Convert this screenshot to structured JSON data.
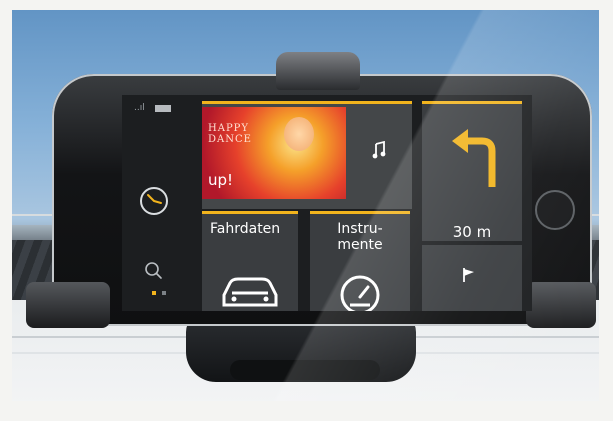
{
  "status_bar": {
    "signal": "..ıl"
  },
  "music": {
    "album_title": "HAPPY\nDANCE",
    "album_subtitle": "up!",
    "icon": "music-note-icon"
  },
  "navigation": {
    "icon": "turn-left-arrow-icon",
    "distance": "30 m",
    "flag_icon": "destination-flag-icon"
  },
  "tiles": {
    "fahrdaten_label": "Fahrdaten",
    "instrumente_label": "Instru-\nmente"
  },
  "side": {
    "clock_icon": "clock-icon",
    "search_icon": "search-icon"
  },
  "colors": {
    "accent": "#f2b41d",
    "tile": "#3a3d40"
  }
}
